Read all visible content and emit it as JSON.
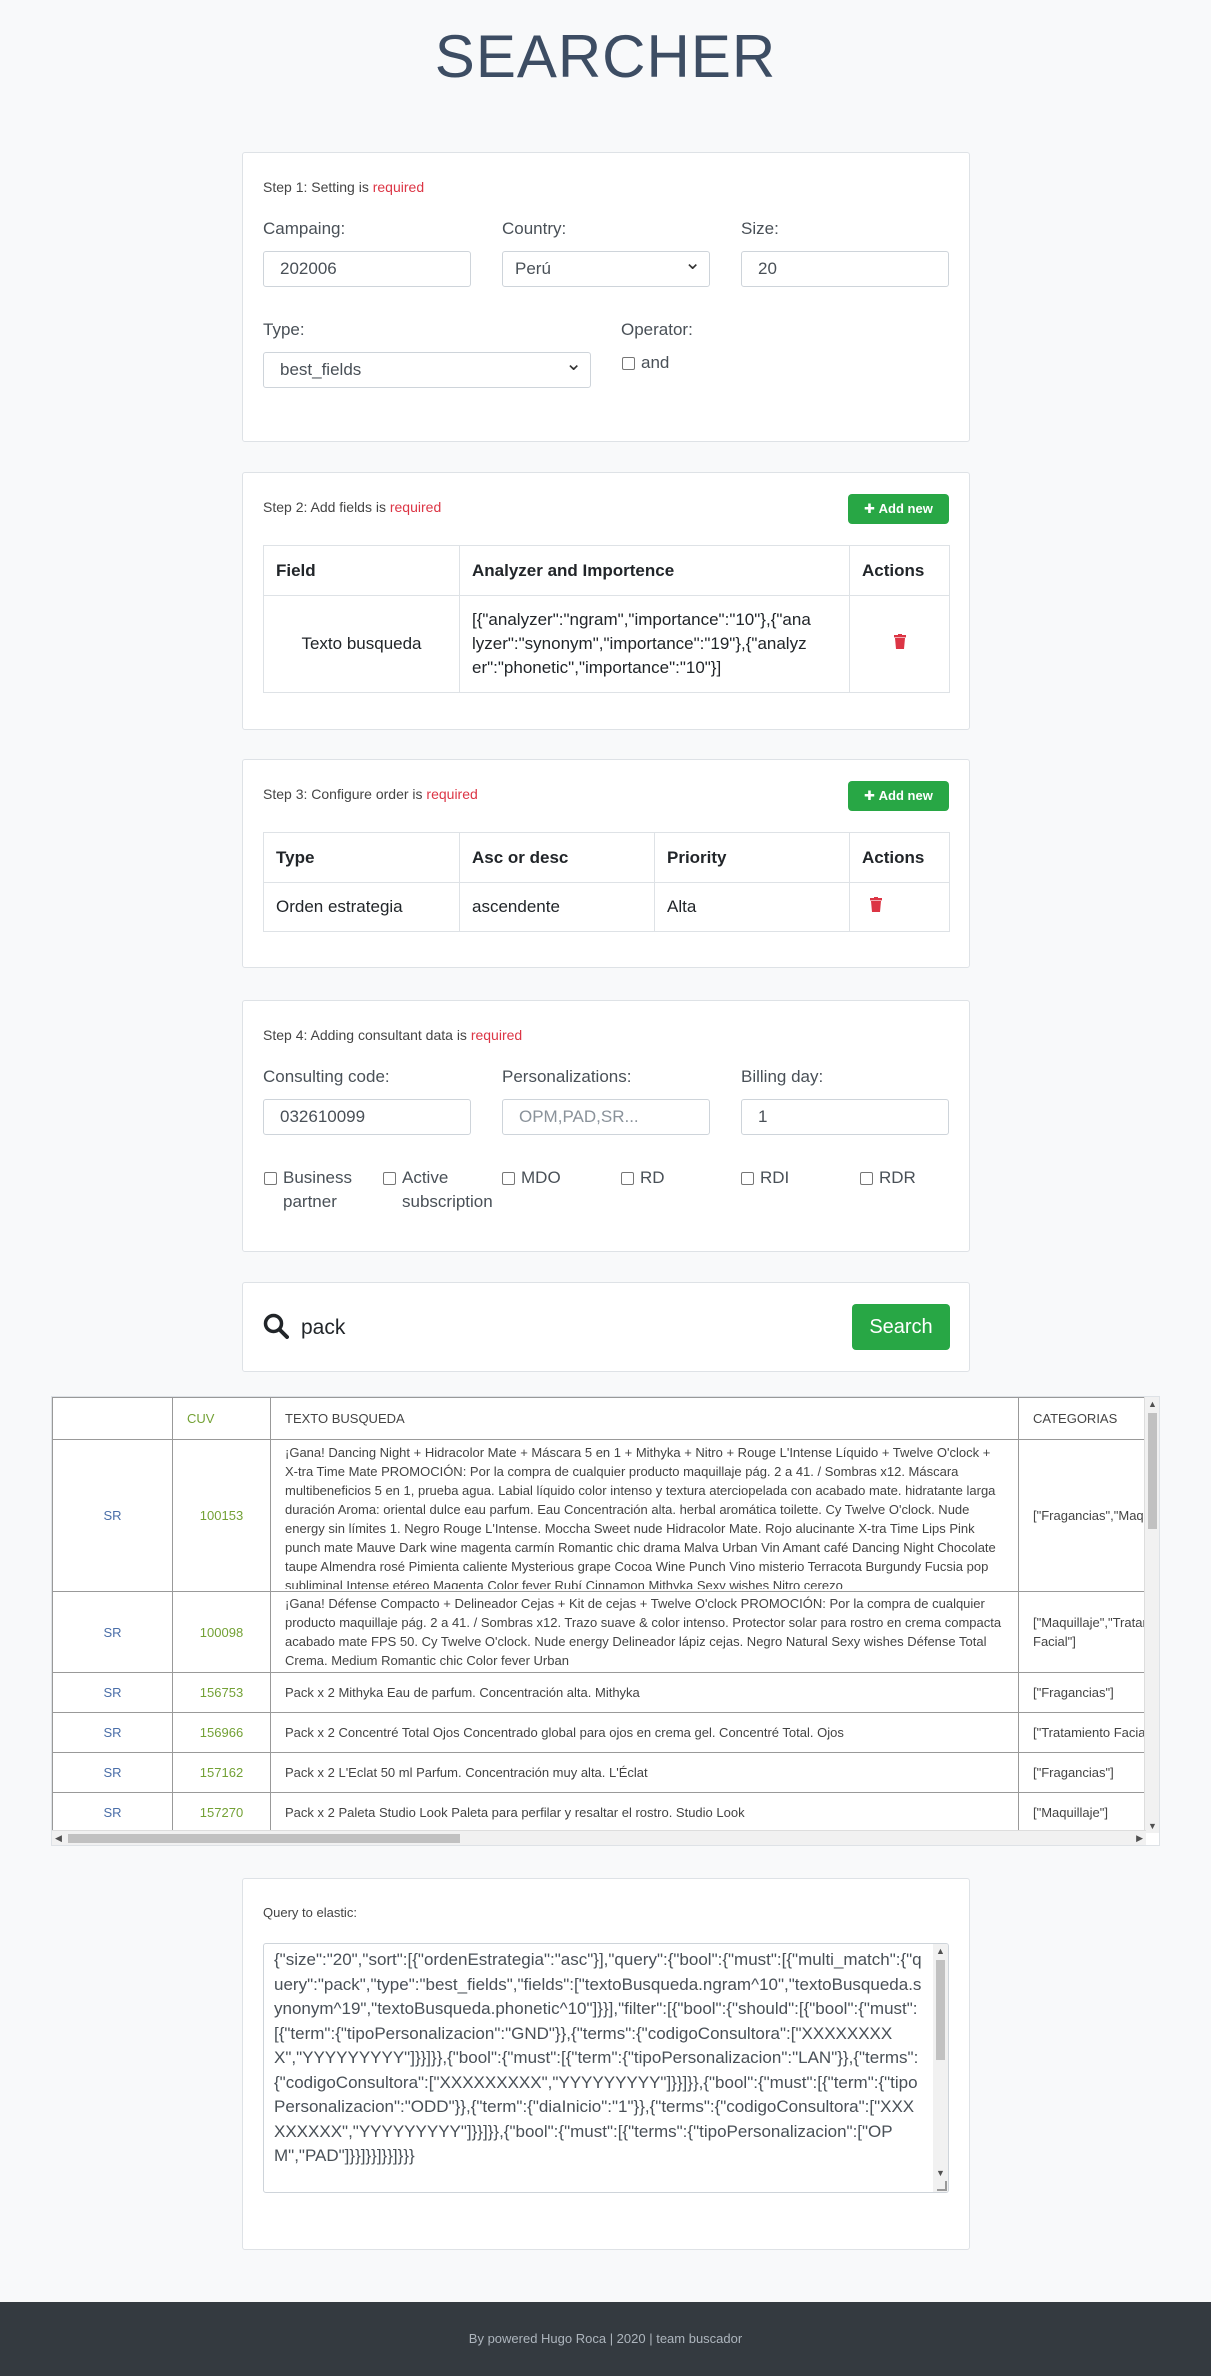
{
  "page": {
    "title": "SEARCHER"
  },
  "step1": {
    "text": "Step 1: Setting is ",
    "required": "required",
    "campaign_label": "Campaing:",
    "campaign_value": "202006",
    "country_label": "Country:",
    "country_value": "Perú",
    "size_label": "Size:",
    "size_value": "20",
    "type_label": "Type:",
    "type_value": "best_fields",
    "operator_label": "Operator:",
    "operator_option": "and"
  },
  "step2": {
    "text": "Step 2: Add fields is ",
    "required": "required",
    "add_label": "Add new",
    "headers": [
      "Field",
      "Analyzer and Importence",
      "Actions"
    ],
    "rows": [
      {
        "field": "Texto busqueda",
        "analyzer": "[{\"analyzer\":\"ngram\",\"importance\":\"10\"},{\"analyzer\":\"synonym\",\"importance\":\"19\"},{\"analyzer\":\"phonetic\",\"importance\":\"10\"}]"
      }
    ]
  },
  "step3": {
    "text": "Step 3: Configure order is ",
    "required": "required",
    "add_label": "Add new",
    "headers": [
      "Type",
      "Asc or desc",
      "Priority",
      "Actions"
    ],
    "rows": [
      {
        "type": "Orden estrategia",
        "order": "ascendente",
        "priority": "Alta"
      }
    ]
  },
  "step4": {
    "text": "Step 4: Adding consultant data is ",
    "required": "required",
    "code_label": "Consulting code:",
    "code_value": "032610099",
    "pers_label": "Personalizations:",
    "pers_placeholder": "OPM,PAD,SR...",
    "billing_label": "Billing day:",
    "billing_value": "1",
    "checkboxes": [
      "Business partner",
      "Active subscription",
      "MDO",
      "RD",
      "RDI",
      "RDR"
    ]
  },
  "search": {
    "value": "pack",
    "button_label": "Search"
  },
  "results": {
    "headers": [
      "",
      "CUV",
      "TEXTO BUSQUEDA",
      "CATEGORIAS"
    ],
    "rows": [
      {
        "type": "SR",
        "cuv": "100153",
        "text": "¡Gana! Dancing Night + Hidracolor Mate + Máscara 5 en 1 + Mithyka + Nitro + Rouge L'Intense Líquido + Twelve O'clock + X-tra Time Mate PROMOCIÓN: Por la compra de cualquier producto maquillaje pág. 2 a 41. / Sombras x12. Máscara multibeneficios 5 en 1, prueba agua. Labial líquido color intenso y textura aterciopelada con acabado mate. hidratante larga duración Aroma: oriental dulce eau parfum. Eau Concentración alta. herbal aromática toilette. Cy Twelve O'clock. Nude energy sin límites 1. Negro Rouge L'Intense. Moccha Sweet nude Hidracolor Mate. Rojo alucinante X-tra Time Lips Pink punch mate Mauve Dark wine magenta carmín Romantic chic drama Malva Urban Vin Amant café Dancing Night Chocolate taupe Almendra rosé Pimienta caliente Mysterious grape Cocoa Wine Punch Vino misterio Terracota Burgundy Fucsia pop subliminal Intense etéreo Magenta Color fever Rubí Cinnamon Mithyka Sexy wishes Nitro cerezo",
        "cat": "[\"Fragancias\",\"Maquillaje\"]"
      },
      {
        "type": "SR",
        "cuv": "100098",
        "text": "¡Gana! Défense Compacto + Delineador Cejas + Kit de cejas + Twelve O'clock PROMOCIÓN: Por la compra de cualquier producto maquillaje pág. 2 a 41. / Sombras x12. Trazo suave & color intenso. Protector solar para rostro en crema compacta acabado mate FPS 50. Cy Twelve O'clock. Nude energy Delineador lápiz cejas. Negro Natural Sexy wishes Défense Total Crema. Medium Romantic chic Color fever Urban",
        "cat": "[\"Maquillaje\",\"Tratamiento Facial\"]"
      },
      {
        "type": "SR",
        "cuv": "156753",
        "text": "Pack x 2 Mithyka Eau de parfum. Concentración alta. Mithyka",
        "cat": "[\"Fragancias\"]"
      },
      {
        "type": "SR",
        "cuv": "156966",
        "text": "Pack x 2 Concentré Total Ojos Concentrado global para ojos en crema gel. Concentré Total. Ojos",
        "cat": "[\"Tratamiento Facial\"]"
      },
      {
        "type": "SR",
        "cuv": "157162",
        "text": "Pack x 2 L'Eclat 50 ml Parfum. Concentración muy alta. L'Éclat",
        "cat": "[\"Fragancias\"]"
      },
      {
        "type": "SR",
        "cuv": "157270",
        "text": "Pack x 2 Paleta Studio Look Paleta para perfilar y resaltar el rostro. Studio Look",
        "cat": "[\"Maquillaje\"]"
      }
    ]
  },
  "query": {
    "label": "Query to elastic:",
    "text": "{\"size\":\"20\",\"sort\":[{\"ordenEstrategia\":\"asc\"}],\"query\":{\"bool\":{\"must\":[{\"multi_match\":{\"query\":\"pack\",\"type\":\"best_fields\",\"fields\":[\"textoBusqueda.ngram^10\",\"textoBusqueda.synonym^19\",\"textoBusqueda.phonetic^10\"]}}],\"filter\":[{\"bool\":{\"should\":[{\"bool\":{\"must\":[{\"term\":{\"tipoPersonalizacion\":\"GND\"}},{\"terms\":{\"codigoConsultora\":[\"XXXXXXXXX\",\"YYYYYYYYY\"]}}]}},{\"bool\":{\"must\":[{\"term\":{\"tipoPersonalizacion\":\"LAN\"}},{\"terms\":{\"codigoConsultora\":[\"XXXXXXXXX\",\"YYYYYYYYY\"]}}]}},{\"bool\":{\"must\":[{\"term\":{\"tipoPersonalizacion\":\"ODD\"}},{\"term\":{\"diaInicio\":\"1\"}},{\"terms\":{\"codigoConsultora\":[\"XXXXXXXXX\",\"YYYYYYYYY\"]}}]}},{\"bool\":{\"must\":[{\"terms\":{\"tipoPersonalizacion\":[\"OPM\",\"PAD\"]}}]}}]}}]}}}"
  },
  "footer": {
    "text": "By powered Hugo Roca | 2020 | team buscador"
  },
  "icons": {
    "search": "search-icon",
    "trash": "trash-icon",
    "plus": "plus-icon"
  },
  "colors": {
    "green": "#28a745",
    "red": "#dc3545",
    "title": "#3d4d63",
    "footer": "#343a40"
  }
}
